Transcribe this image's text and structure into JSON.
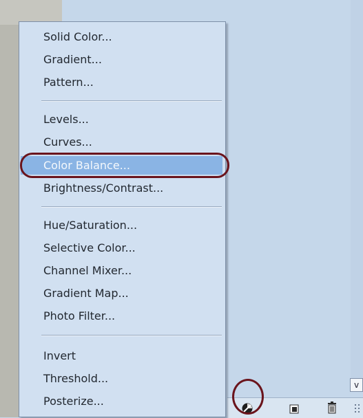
{
  "menu": {
    "groups": [
      {
        "items": [
          "Solid Color...",
          "Gradient...",
          "Pattern..."
        ]
      },
      {
        "items": [
          "Levels...",
          "Curves...",
          "Color Balance...",
          "Brightness/Contrast..."
        ]
      },
      {
        "items": [
          "Hue/Saturation...",
          "Selective Color...",
          "Channel Mixer...",
          "Gradient Map...",
          "Photo Filter..."
        ]
      },
      {
        "items": [
          "Invert",
          "Threshold...",
          "Posterize..."
        ]
      }
    ],
    "selected_item": "Color Balance..."
  },
  "scroll_chevron": "v",
  "icons": {
    "adjustment_layer": "adjustment-layer-icon",
    "new_layer": "new-layer-icon",
    "trash": "trash-icon",
    "resize_grip": "resize-grip-icon"
  },
  "colors": {
    "menu_bg": "#d1e0f1",
    "selected_bg": "#8ab4e4",
    "annotation": "#6a141c"
  }
}
